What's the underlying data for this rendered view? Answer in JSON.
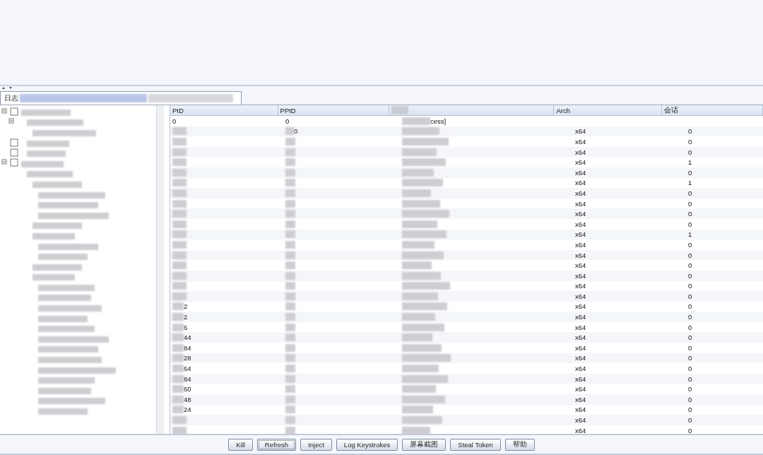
{
  "tab": {
    "label": "日志"
  },
  "table": {
    "columns": [
      {
        "label": "PID"
      },
      {
        "label": "PPID"
      },
      {
        "kind": "blurred"
      },
      {
        "label": "Arch"
      },
      {
        "label": "会话"
      }
    ],
    "rows": [
      {
        "pid": "0",
        "ppid": "0",
        "name": "cess]"
      },
      {
        "ppid": "0",
        "arch": "x64",
        "session": "0"
      },
      {
        "arch": "x64",
        "session": "0"
      },
      {
        "arch": "x64",
        "session": "0"
      },
      {
        "arch": "x64",
        "session": "1"
      },
      {
        "arch": "x64",
        "session": "0"
      },
      {
        "arch": "x64",
        "session": "1"
      },
      {
        "arch": "x64",
        "session": "0"
      },
      {
        "arch": "x64",
        "session": "0"
      },
      {
        "arch": "x64",
        "session": "0"
      },
      {
        "arch": "x64",
        "session": "0"
      },
      {
        "arch": "x64",
        "session": "1"
      },
      {
        "arch": "x64",
        "session": "0"
      },
      {
        "arch": "x64",
        "session": "0"
      },
      {
        "arch": "x64",
        "session": "0"
      },
      {
        "arch": "x64",
        "session": "0"
      },
      {
        "arch": "x64",
        "session": "0"
      },
      {
        "arch": "x64",
        "session": "0"
      },
      {
        "pid": "2",
        "arch": "x64",
        "session": "0"
      },
      {
        "pid": "2",
        "arch": "x64",
        "session": "0"
      },
      {
        "pid": "6",
        "arch": "x64",
        "session": "0"
      },
      {
        "pid": "44",
        "arch": "x64",
        "session": "0"
      },
      {
        "pid": "84",
        "arch": "x64",
        "session": "0"
      },
      {
        "pid": "28",
        "arch": "x64",
        "session": "0"
      },
      {
        "pid": "64",
        "arch": "x64",
        "session": "0"
      },
      {
        "pid": "84",
        "arch": "x64",
        "session": "0"
      },
      {
        "pid": "60",
        "arch": "x64",
        "session": "0"
      },
      {
        "pid": "48",
        "arch": "x64",
        "session": "0"
      },
      {
        "pid": "24",
        "arch": "x64",
        "session": "0"
      },
      {
        "arch": "x64",
        "session": "0"
      },
      {
        "arch": "x64",
        "session": "0"
      }
    ]
  },
  "buttons": [
    {
      "label": "Kill",
      "focused": false
    },
    {
      "label": "Refresh",
      "focused": true
    },
    {
      "label": "Inject",
      "focused": false
    },
    {
      "label": "Log Keystrokes",
      "focused": false
    },
    {
      "label": "屏幕截图",
      "focused": false
    },
    {
      "label": "Steal Token",
      "focused": false
    },
    {
      "label": "帮助",
      "focused": false
    }
  ]
}
